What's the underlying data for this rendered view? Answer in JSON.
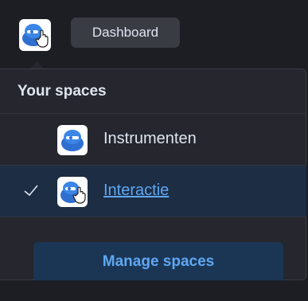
{
  "header": {
    "breadcrumb_label": "Dashboard",
    "space_avatar_icon": "space-logo-icon"
  },
  "spaces_popover": {
    "title": "Your spaces",
    "items": [
      {
        "label": "Instrumenten",
        "icon": "space-logo-icon",
        "selected": false
      },
      {
        "label": "Interactie",
        "icon": "space-logo-icon",
        "selected": true
      }
    ],
    "manage_button_label": "Manage spaces"
  },
  "colors": {
    "accent": "#5fa7f2",
    "selected_bg": "#1c2d44",
    "button_bg": "#1b3655",
    "panel_bg": "#25262e"
  }
}
